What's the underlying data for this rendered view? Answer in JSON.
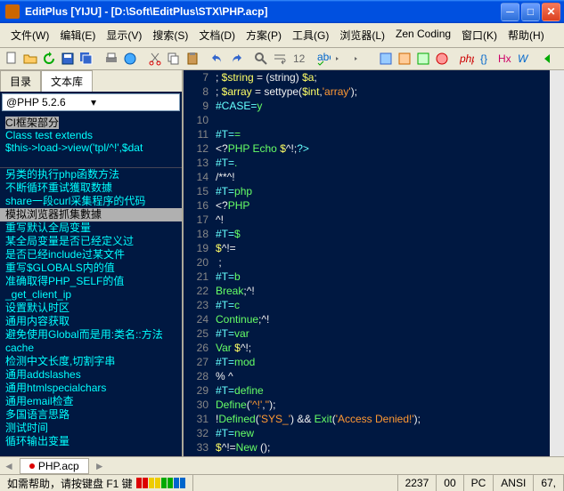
{
  "title": "EditPlus [YIJU] - [D:\\Soft\\EditPlus\\STX\\PHP.acp]",
  "menu": [
    "文件(W)",
    "编辑(E)",
    "显示(V)",
    "搜索(S)",
    "文档(D)",
    "方案(P)",
    "工具(G)",
    "浏览器(L)",
    "Zen Coding",
    "窗口(K)",
    "帮助(H)"
  ],
  "side_tabs": {
    "a": "目录",
    "b": "文本库"
  },
  "combo": "@PHP 5.2.6",
  "snip_top": [
    "CI框架部分",
    "",
    "Class test extends",
    "$this->load->view('tpl/^!',$dat"
  ],
  "snip_list": [
    {
      "t": "另类的执行php函数方法"
    },
    {
      "t": "不断循环重试獲取数據"
    },
    {
      "t": "share一段curl采集程序的代码"
    },
    {
      "t": "模拟浏览器抓集數據",
      "sel": true
    },
    {
      "t": "重写默认全局变量"
    },
    {
      "t": "某全局变量是否已经定义过"
    },
    {
      "t": "是否已经include过某文件"
    },
    {
      "t": "重写$GLOBALS内的值"
    },
    {
      "t": "准确取得PHP_SELF的值"
    },
    {
      "t": "_get_client_ip"
    },
    {
      "t": "设置默认时区"
    },
    {
      "t": "通用内容获取"
    },
    {
      "t": "避免使用Global而是用:类名::方法"
    },
    {
      "t": "cache"
    },
    {
      "t": "检测中文长度,切割字串"
    },
    {
      "t": "通用addslashes"
    },
    {
      "t": "通用htmlspecialchars"
    },
    {
      "t": "通用email检查"
    },
    {
      "t": "多国语言思路"
    },
    {
      "t": ""
    },
    {
      "t": "测试时间"
    },
    {
      "t": "循环输出变量"
    }
  ],
  "code": [
    {
      "n": 7,
      "h": "; $string = (string) $a;"
    },
    {
      "n": 8,
      "h": "; $array = settype($int,'array');"
    },
    {
      "n": 9,
      "h": "#CASE=y"
    },
    {
      "n": 10,
      "h": ""
    },
    {
      "n": 11,
      "h": "#T=="
    },
    {
      "n": 12,
      "h": "<?PHP Echo $^!;?>"
    },
    {
      "n": 13,
      "h": "#T=."
    },
    {
      "n": 14,
      "h": "/**^!"
    },
    {
      "n": 15,
      "h": "#T=php"
    },
    {
      "n": 16,
      "h": "<?PHP"
    },
    {
      "n": 17,
      "h": "^!"
    },
    {
      "n": 18,
      "h": "#T=$"
    },
    {
      "n": 19,
      "h": "$^!="
    },
    {
      "n": 20,
      "h": " ;"
    },
    {
      "n": 21,
      "h": "#T=b"
    },
    {
      "n": 22,
      "h": "Break;^!"
    },
    {
      "n": 23,
      "h": "#T=c"
    },
    {
      "n": 24,
      "h": "Continue;^!"
    },
    {
      "n": 25,
      "h": "#T=var"
    },
    {
      "n": 26,
      "h": "Var $^!;"
    },
    {
      "n": 27,
      "h": "#T=mod"
    },
    {
      "n": 28,
      "h": "% ^"
    },
    {
      "n": 29,
      "h": "#T=define"
    },
    {
      "n": 30,
      "h": "Define('^!','');"
    },
    {
      "n": 31,
      "h": "!Defined('SYS_') && Exit('Access Denied!');"
    },
    {
      "n": 32,
      "h": "#T=new"
    },
    {
      "n": 33,
      "h": "$^!=New ();"
    }
  ],
  "doc_tab": "PHP.acp",
  "status": {
    "help": "如需帮助，请按键盘 F1 键",
    "line": "2237",
    "col": "00",
    "mode": "PC",
    "enc": "ANSI",
    "pos": "67,"
  }
}
